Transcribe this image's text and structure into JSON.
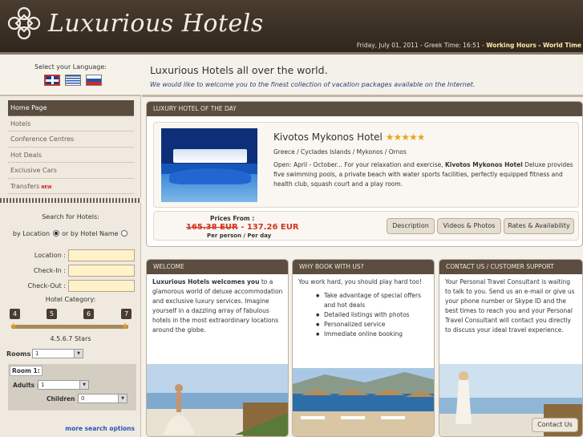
{
  "brand": {
    "name": "Luxurious Hotels"
  },
  "header_bar": {
    "datetime": "Friday, July 01, 2011 - Greek Time: 16:51 -",
    "working_hours": "Working Hours",
    "world_time": "- World Time"
  },
  "language": {
    "title": "Select your Language:",
    "flags": [
      "uk-flag-icon",
      "greece-flag-icon",
      "russia-flag-icon"
    ]
  },
  "nav": {
    "items": [
      {
        "label": "Home Page",
        "active": true
      },
      {
        "label": "Hotels"
      },
      {
        "label": "Conference Centres"
      },
      {
        "label": "Hot Deals"
      },
      {
        "label": "Exclusive Cars"
      },
      {
        "label": "Transfers",
        "badge": "NEW"
      }
    ]
  },
  "search": {
    "title": "Search for Hotels:",
    "by_location": "by Location",
    "by_name": "or by Hotel Name",
    "location_label": "Location :",
    "checkin_label": "Check-In :",
    "checkout_label": "Check-Out :",
    "category_title": "Hotel Category:",
    "star_labels": [
      "4",
      "5",
      "6",
      "7"
    ],
    "stars_text": "4.5.6.7 Stars",
    "rooms_label": "Rooms :",
    "rooms_value": "1",
    "room_tab": "Room 1:",
    "adults_label": "Adults :",
    "adults_value": "1",
    "children_label": "Children :",
    "children_value": "0",
    "more_options": "more search options"
  },
  "main": {
    "title": "Luxurious Hotels all over the world.",
    "subtitle": "We would like to welcome you to the finest collection of vacation packages available on the Internet."
  },
  "hotel_of_day": {
    "header": "LUXURY HOTEL OF THE DAY",
    "name": "Kivotos Mykonos Hotel",
    "stars": "★★★★★",
    "location": "Greece / Cyclades Islands / Mykonos / Ornos",
    "desc_pre": "Open: April - October... For your relaxation and exercise,",
    "desc_bold": "Kivotos Mykonos Hotel",
    "desc_post": "Deluxe provides five swimming pools, a private beach with water sports facilities, perfectly equipped fitness and health club, squash court and a play room.",
    "prices_from": "Prices From :",
    "old_price": "165.38 EUR",
    "new_price": "- 137.26 EUR",
    "per": "Per person / Per day",
    "tabs": [
      "Description",
      "Videos & Photos",
      "Rates & Availability"
    ]
  },
  "columns": {
    "welcome": {
      "header": "WELCOME",
      "bold": "Luxurious Hotels welcomes you",
      "text": "to a glamorous world of deluxe accommodation and exclusive luxury services. Imagine yourself in a dazzling array of fabulous hotels in the most extraordinary locations around the globe."
    },
    "why": {
      "header": "WHY BOOK WITH US?",
      "intro": "You work hard, you should play hard too!",
      "bullets": [
        "Take advantage of special offers and hot deals",
        "Detailed listings with photos",
        "Personalized service",
        "Immediate online booking"
      ]
    },
    "contact": {
      "header": "CONTACT US / CUSTOMER SUPPORT",
      "text": "Your Personal Travel Consultant is waiting to talk to you. Send us an e-mail or give us your phone number or Skype ID and the best times to reach you and your Personal Travel Consultant will contact you directly to discuss your ideal travel experience.",
      "button": "Contact Us"
    }
  },
  "colors": {
    "header": "#2f261d",
    "panel_head": "#5b4d40",
    "price": "#d2341e",
    "star": "#e8a521"
  }
}
